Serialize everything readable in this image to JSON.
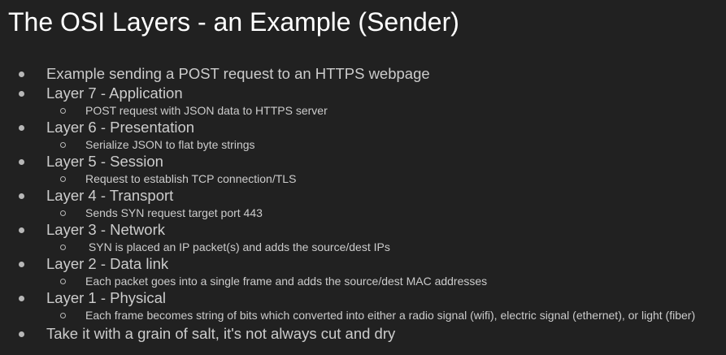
{
  "slide": {
    "title": "The OSI Layers - an Example (Sender)",
    "intro": "Example sending a POST request to an HTTPS webpage",
    "layers": [
      {
        "heading": "Layer 7 - Application",
        "detail": "POST request with JSON data to HTTPS server"
      },
      {
        "heading": "Layer 6 - Presentation",
        "detail": "Serialize JSON to flat byte strings"
      },
      {
        "heading": "Layer 5 - Session",
        "detail": "Request to establish TCP connection/TLS"
      },
      {
        "heading": "Layer 4 - Transport",
        "detail": "Sends SYN request target port 443"
      },
      {
        "heading": "Layer 3 - Network",
        "detail": " SYN is placed an IP packet(s) and adds the source/dest IPs"
      },
      {
        "heading": "Layer 2 - Data link",
        "detail": "Each packet goes into a single frame and adds the source/dest MAC addresses"
      },
      {
        "heading": "Layer 1 - Physical",
        "detail": "Each frame becomes string of bits which converted into either a radio signal (wifi), electric signal (ethernet), or light (fiber)"
      }
    ],
    "closing": "Take it with a grain of salt, it's not always cut and dry"
  },
  "colors": {
    "background": "#212121",
    "title": "#ffffff",
    "body_text": "#cccccc",
    "bullet": "#b7b7b7"
  }
}
